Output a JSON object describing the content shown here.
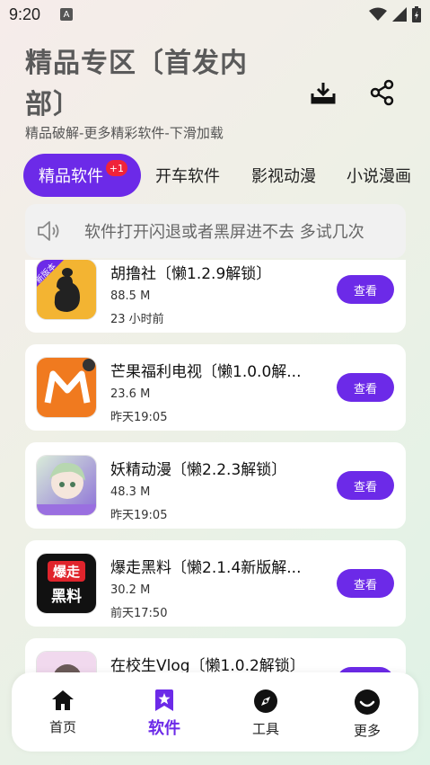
{
  "status_bar": {
    "time": "9:20",
    "notif_letter": "A"
  },
  "header": {
    "title_line1": "精品专区〔首发内",
    "title_line2": "部〕",
    "subtitle": "精品破解-更多精彩软件-下滑加载"
  },
  "tabs": [
    {
      "label": "精品软件",
      "badge": "+1",
      "active": true
    },
    {
      "label": "开车软件"
    },
    {
      "label": "影视动漫"
    },
    {
      "label": "小说漫画"
    }
  ],
  "notice": {
    "text": "软件打开闪退或者黑屏进不去 多试几次"
  },
  "apps": [
    {
      "name": "胡撸社〔懒1.2.9解锁〕",
      "size": "88.5 M",
      "time": "23 小时前",
      "button": "查看",
      "ribbon": "新版本"
    },
    {
      "name": "芒果福利电视〔懒1.0.0解...",
      "size": "23.6 M",
      "time": "昨天19:05",
      "button": "查看"
    },
    {
      "name": "妖精动漫〔懒2.2.3解锁〕",
      "size": "48.3 M",
      "time": "昨天19:05",
      "button": "查看"
    },
    {
      "name": "爆走黑料〔懒2.1.4新版解...",
      "size": "30.2 M",
      "time": "前天17:50",
      "button": "查看",
      "icon_text_top": "爆走",
      "icon_text_bottom": "黑料"
    },
    {
      "name": "在校生Vlog〔懒1.0.2解锁〕",
      "size": "",
      "time": "",
      "button": "查看"
    }
  ],
  "bottom_nav": [
    {
      "label": "首页",
      "icon": "home-icon"
    },
    {
      "label": "软件",
      "icon": "star-bookmark-icon",
      "active": true
    },
    {
      "label": "工具",
      "icon": "compass-icon"
    },
    {
      "label": "更多",
      "icon": "smile-icon"
    }
  ],
  "colors": {
    "accent": "#6c2ae8",
    "badge": "#f0233a"
  }
}
